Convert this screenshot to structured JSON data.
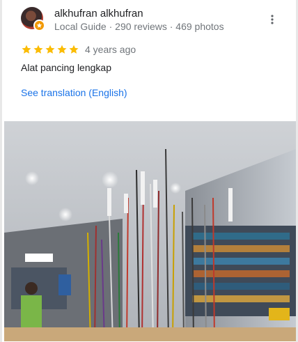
{
  "reviewer": {
    "name": "alkhufran alkhufran",
    "meta": "Local Guide · 290 reviews · 469 photos"
  },
  "review": {
    "rating": 5,
    "max_rating": 5,
    "time": "4 years ago",
    "text": "Alat pancing lengkap",
    "translate_link": "See translation (English)"
  },
  "colors": {
    "star": "#fbbc04",
    "link": "#1a73e8",
    "badge": "#f29900"
  },
  "icons": {
    "more": "more-vert-icon",
    "badge": "local-guide-badge-icon",
    "star": "star-icon"
  }
}
